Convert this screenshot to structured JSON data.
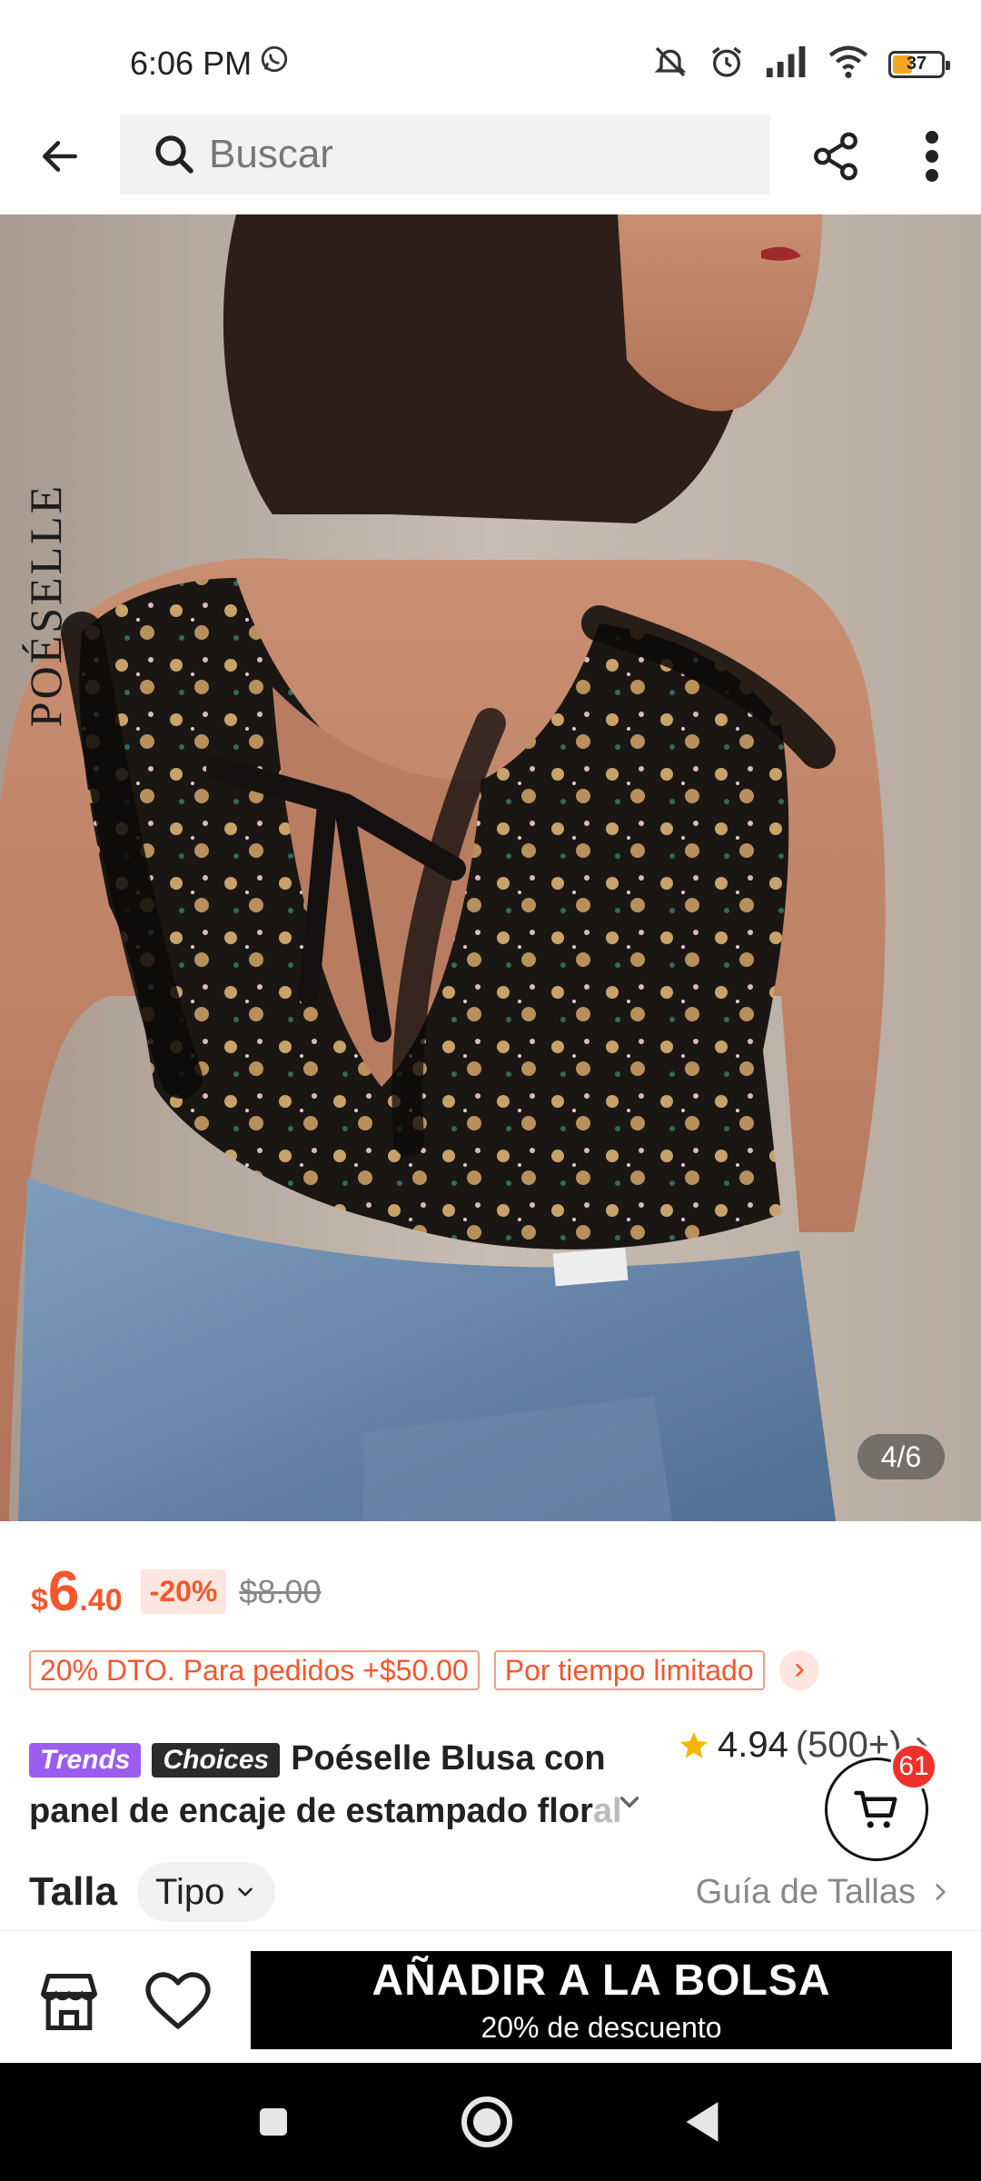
{
  "status_bar": {
    "time": "6:06 PM",
    "battery": "37",
    "icons": [
      "whatsapp-icon",
      "mute-icon",
      "alarm-icon",
      "signal-icon",
      "wifi-icon",
      "battery-icon"
    ]
  },
  "top_bar": {
    "search_placeholder": "Buscar",
    "icons": [
      "back-arrow-icon",
      "search-icon",
      "share-icon",
      "more-vertical-icon"
    ]
  },
  "gallery": {
    "brand_watermark": "POÉSELLE",
    "page_indicator": "4/6",
    "current": 4,
    "total": 6
  },
  "price": {
    "currency": "$",
    "integer": "6",
    "decimal": ".40",
    "discount": "-20%",
    "original": "$8.00",
    "accent_color": "#f5572c"
  },
  "promos": {
    "tag1": "20% DTO. Para pedidos +$50.00",
    "tag2": "Por tiempo limitado"
  },
  "product": {
    "badge_trends": "Trends",
    "badge_choices": "Choices",
    "title_line1": "Poéselle Blusa con",
    "title_line2_visible": "panel de encaje de estampado flor",
    "title_line2_faded": "al",
    "rating": "4.94",
    "rating_count": "(500+)"
  },
  "cart": {
    "count": "61"
  },
  "size": {
    "label": "Talla",
    "type_chip": "Tipo",
    "guide": "Guía de Tallas"
  },
  "actions": {
    "add_to_bag": "AÑADIR A LA BOLSA",
    "add_to_bag_sub": "20% de descuento",
    "icons": [
      "store-icon",
      "heart-icon"
    ]
  },
  "nav": {
    "icons": [
      "recents-icon",
      "home-icon",
      "back-icon"
    ]
  }
}
